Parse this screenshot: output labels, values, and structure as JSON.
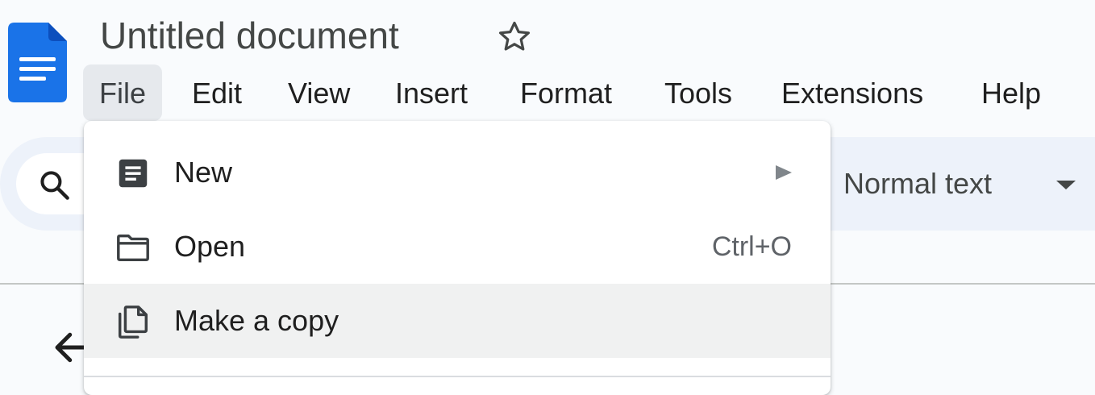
{
  "app": {
    "title": "Untitled document",
    "logo_icon": "google-docs-icon",
    "brand_color": "#1a73e8"
  },
  "menubar": {
    "items": [
      {
        "label": "File",
        "active": true
      },
      {
        "label": "Edit"
      },
      {
        "label": "View"
      },
      {
        "label": "Insert"
      },
      {
        "label": "Format"
      },
      {
        "label": "Tools"
      },
      {
        "label": "Extensions"
      },
      {
        "label": "Help"
      }
    ]
  },
  "toolbar": {
    "search_icon": "search-icon",
    "paragraph_style": "Normal text"
  },
  "file_menu": {
    "items": [
      {
        "label": "New",
        "icon": "new-document-icon",
        "submenu": true
      },
      {
        "label": "Open",
        "icon": "folder-icon",
        "shortcut": "Ctrl+O"
      },
      {
        "label": "Make a copy",
        "icon": "copy-icon",
        "highlighted": true
      }
    ]
  },
  "colors": {
    "background": "#f9fbfd",
    "toolbar": "#edf2fa",
    "menu_highlight": "#f0f1f1",
    "active_menu": "#e6e9ed"
  }
}
